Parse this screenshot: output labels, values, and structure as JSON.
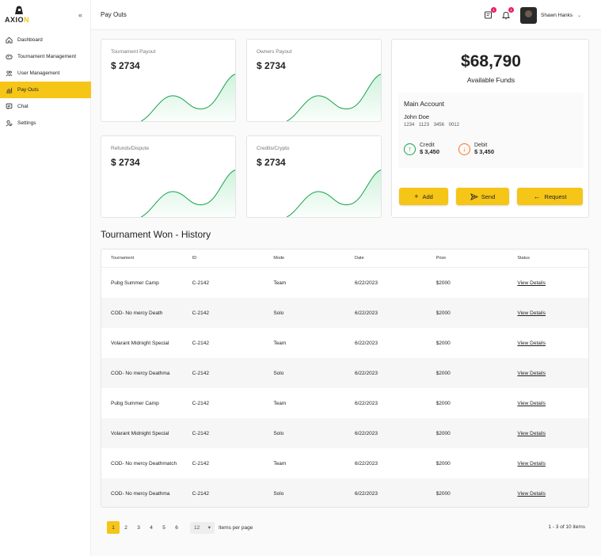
{
  "brand": {
    "name_dark": "AXIO",
    "name_accent": "N",
    "accent": "#f5c518"
  },
  "sidebar": {
    "items": [
      {
        "label": "Dashboard",
        "icon": "home-icon",
        "active": false
      },
      {
        "label": "Tournament Management",
        "icon": "gamepad-icon",
        "active": false
      },
      {
        "label": "User Management",
        "icon": "users-icon",
        "active": false
      },
      {
        "label": "Pay Outs",
        "icon": "chart-icon",
        "active": true
      },
      {
        "label": "Chat",
        "icon": "chat-icon",
        "active": false
      },
      {
        "label": "Settings",
        "icon": "settings-icon",
        "active": false
      }
    ]
  },
  "header": {
    "title": "Pay Outs",
    "messages_badge": "1",
    "notifications_badge": "1",
    "user_name": "Shawn Hanks"
  },
  "cards": [
    {
      "label": "Tournament Payout",
      "value": "$ 2734"
    },
    {
      "label": "Owners Payout",
      "value": "$ 2734"
    },
    {
      "label": "Refunds/Dispute",
      "value": "$ 2734"
    },
    {
      "label": "Credits/Crypto",
      "value": "$ 2734"
    }
  ],
  "funds": {
    "amount": "$68,790",
    "label": "Available Funds",
    "account_title": "Main Account",
    "holder": "John Doe",
    "number": "1234 1123 3456 0012",
    "credit_label": "Credit",
    "credit_amount": "$ 3,450",
    "debit_label": "Debit",
    "debit_amount": "$ 3,450",
    "add_label": "Add",
    "send_label": "Send",
    "request_label": "Request"
  },
  "history": {
    "title": "Tournament Won - History",
    "columns": [
      "Tournament",
      "ID",
      "Mode",
      "Date",
      "Prize",
      "Status"
    ],
    "rows": [
      {
        "tournament": "Pubg Summer Camp",
        "id": "C-2142",
        "mode": "Team",
        "date": "6/22/2023",
        "prize": "$2000",
        "status": "View Details"
      },
      {
        "tournament": "COD- No mercy Death",
        "id": "C-2142",
        "mode": "Solo",
        "date": "6/22/2023",
        "prize": "$2000",
        "status": "View Details"
      },
      {
        "tournament": "Volarant Midnight Special",
        "id": "C-2142",
        "mode": "Team",
        "date": "6/22/2023",
        "prize": "$2000",
        "status": "View Details"
      },
      {
        "tournament": "COD- No mercy Deathma",
        "id": "C-2142",
        "mode": "Solo",
        "date": "6/22/2023",
        "prize": "$2000",
        "status": "View Details"
      },
      {
        "tournament": "Pubg Summer Camp",
        "id": "C-2142",
        "mode": "Team",
        "date": "6/22/2023",
        "prize": "$2000",
        "status": "View Details"
      },
      {
        "tournament": "Volarant Midnight Special",
        "id": "C-2142",
        "mode": "Solo",
        "date": "6/22/2023",
        "prize": "$2000",
        "status": "View Details"
      },
      {
        "tournament": "COD- No mercy Deathmatch",
        "id": "C-2142",
        "mode": "Team",
        "date": "6/22/2023",
        "prize": "$2000",
        "status": "View Details"
      },
      {
        "tournament": "COD- No mercy Deathma",
        "id": "C-2142",
        "mode": "Solo",
        "date": "6/22/2023",
        "prize": "$2000",
        "status": "View Details"
      }
    ]
  },
  "pagination": {
    "pages": [
      "1",
      "2",
      "3",
      "4",
      "5",
      "6"
    ],
    "current_page": "1",
    "per_page": "12",
    "per_page_label": "Items per page",
    "range": "1 - 3 of 10 items"
  }
}
